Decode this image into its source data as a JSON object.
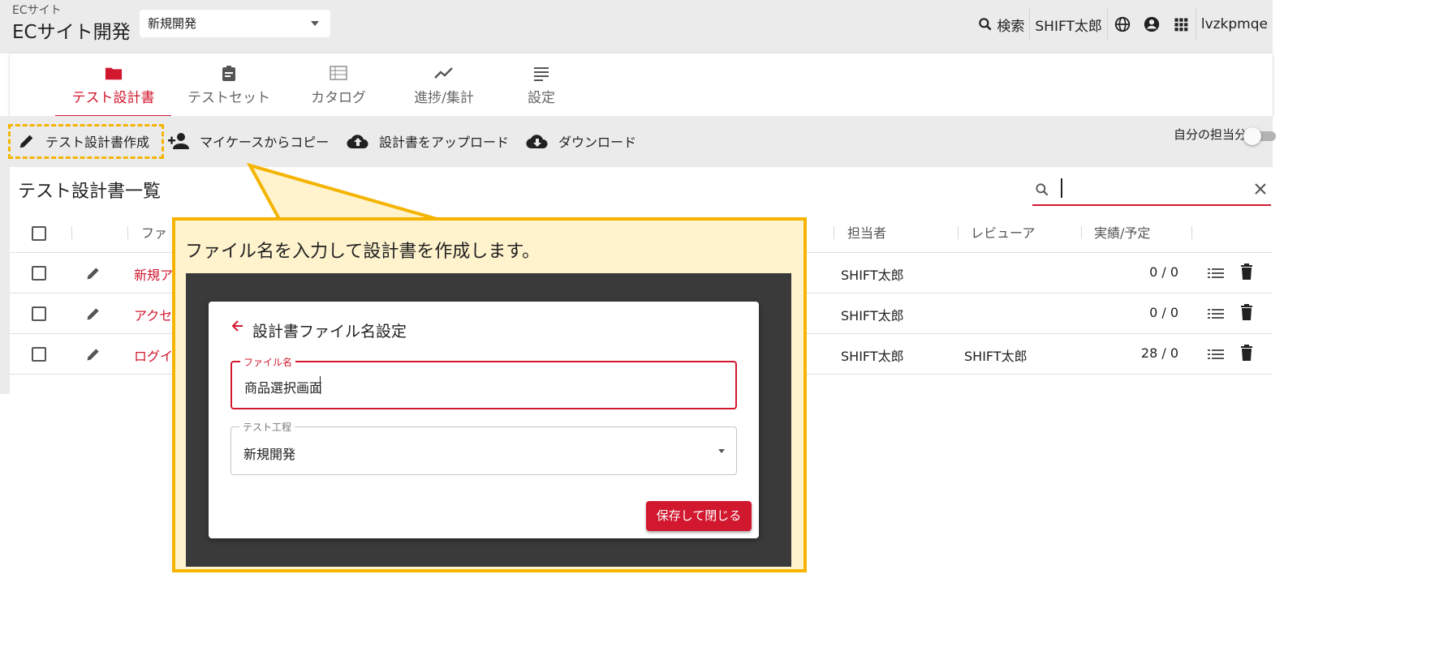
{
  "header": {
    "breadcrumb": "ECサイト",
    "project_title": "ECサイト開発",
    "phase_select": "新規開発",
    "search_label": "検索",
    "user_name": "SHIFT太郎",
    "org_name": "lvzkpmqe"
  },
  "nav": {
    "tabs": [
      {
        "label": "テスト設計書",
        "icon": "folder-icon",
        "active": true
      },
      {
        "label": "テストセット",
        "icon": "clipboard-icon"
      },
      {
        "label": "カタログ",
        "icon": "catalog-icon"
      },
      {
        "label": "進捗/集計",
        "icon": "trend-icon"
      },
      {
        "label": "設定",
        "icon": "settings-list-icon"
      }
    ]
  },
  "toolbar": {
    "create": "テスト設計書作成",
    "copy": "マイケースからコピー",
    "upload": "設計書をアップロード",
    "download": "ダウンロード",
    "mine_toggle": "自分の担当分"
  },
  "list": {
    "title": "テスト設計書一覧",
    "columns": {
      "file": "ファ",
      "assignee": "担当者",
      "reviewer": "レビューア",
      "progress": "実績/予定"
    },
    "rows": [
      {
        "file": "新規ア",
        "assignee": "SHIFT太郎",
        "reviewer": "",
        "progress": "0 / 0"
      },
      {
        "file": "アクセ",
        "assignee": "SHIFT太郎",
        "reviewer": "",
        "progress": "0 / 0"
      },
      {
        "file": "ログイ",
        "assignee": "SHIFT太郎",
        "reviewer": "SHIFT太郎",
        "progress": "28 / 0"
      }
    ]
  },
  "callout": {
    "text": "ファイル名を入力して設計書を作成します。",
    "dialog": {
      "title": "設計書ファイル名設定",
      "file_label": "ファイル名",
      "file_value": "商品選択画面",
      "phase_label": "テスト工程",
      "phase_value": "新規開発",
      "save_button": "保存して閉じる"
    }
  },
  "colors": {
    "accent": "#d1182f",
    "highlight": "#f4b400",
    "callout_bg": "#fff3cd"
  }
}
